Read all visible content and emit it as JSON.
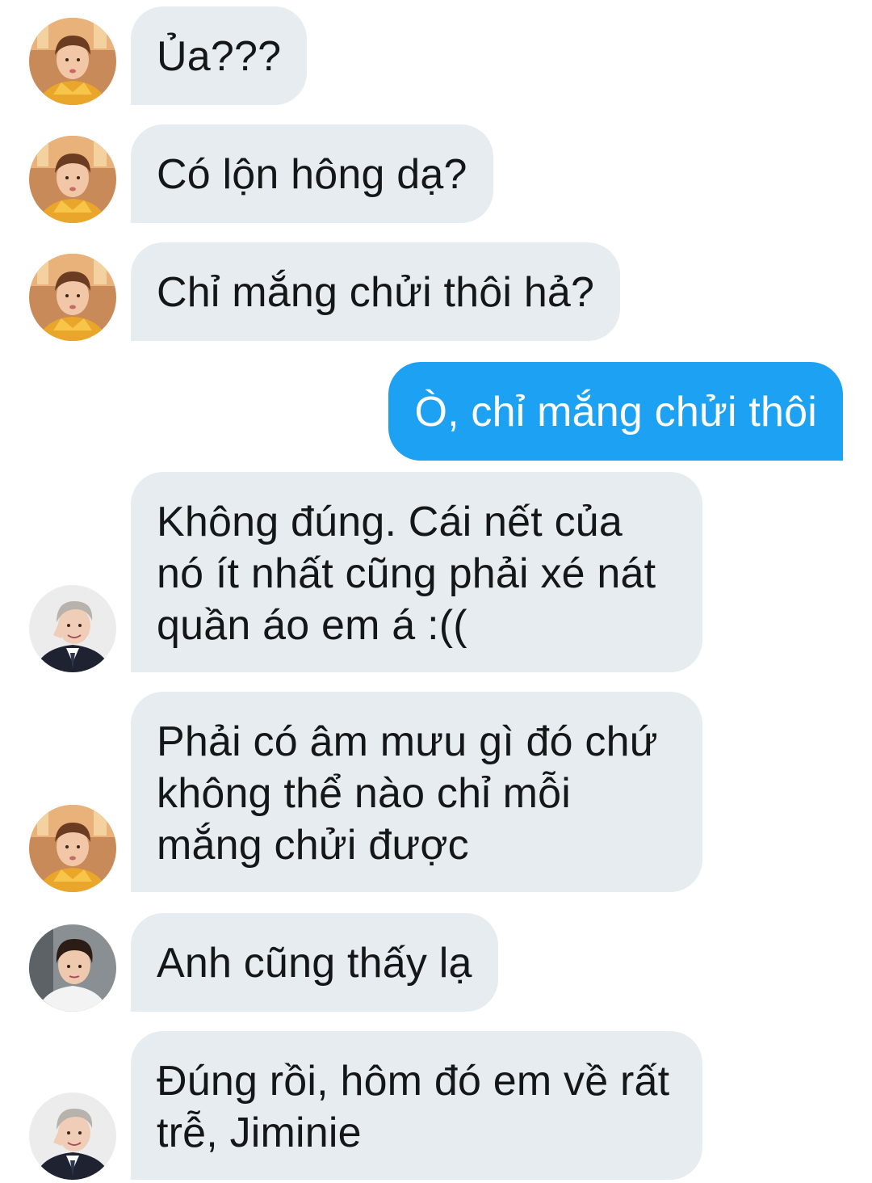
{
  "conversation": {
    "messages": [
      {
        "text": "Ủa???",
        "avatar": "avatar-orange-shirt"
      },
      {
        "text": "Có lộn hông dạ?",
        "avatar": "avatar-orange-shirt"
      },
      {
        "text": "Chỉ mắng chửi thôi hả?",
        "avatar": "avatar-orange-shirt"
      },
      {
        "text": "Ò, chỉ mắng chửi thôi"
      },
      {
        "text": "Không đúng. Cái nết của\nnó ít nhất cũng phải xé nát\nquần áo em á :((",
        "avatar": "avatar-gray-hair-suit"
      },
      {
        "text": "Phải có âm mưu gì đó chứ\nkhông thể nào chỉ mỗi\nmắng chửi được",
        "avatar": "avatar-orange-shirt"
      },
      {
        "text": "Anh cũng thấy lạ",
        "avatar": "avatar-dark-hair-white-shirt"
      },
      {
        "text": "Đúng rồi, hôm đó em về rất\ntrễ, Jiminie",
        "avatar": "avatar-gray-hair-suit"
      }
    ]
  },
  "colors": {
    "received_bubble": "#e6ecf0",
    "sent_bubble": "#1da1f2",
    "text_dark": "#14171a",
    "text_light": "#ffffff"
  }
}
